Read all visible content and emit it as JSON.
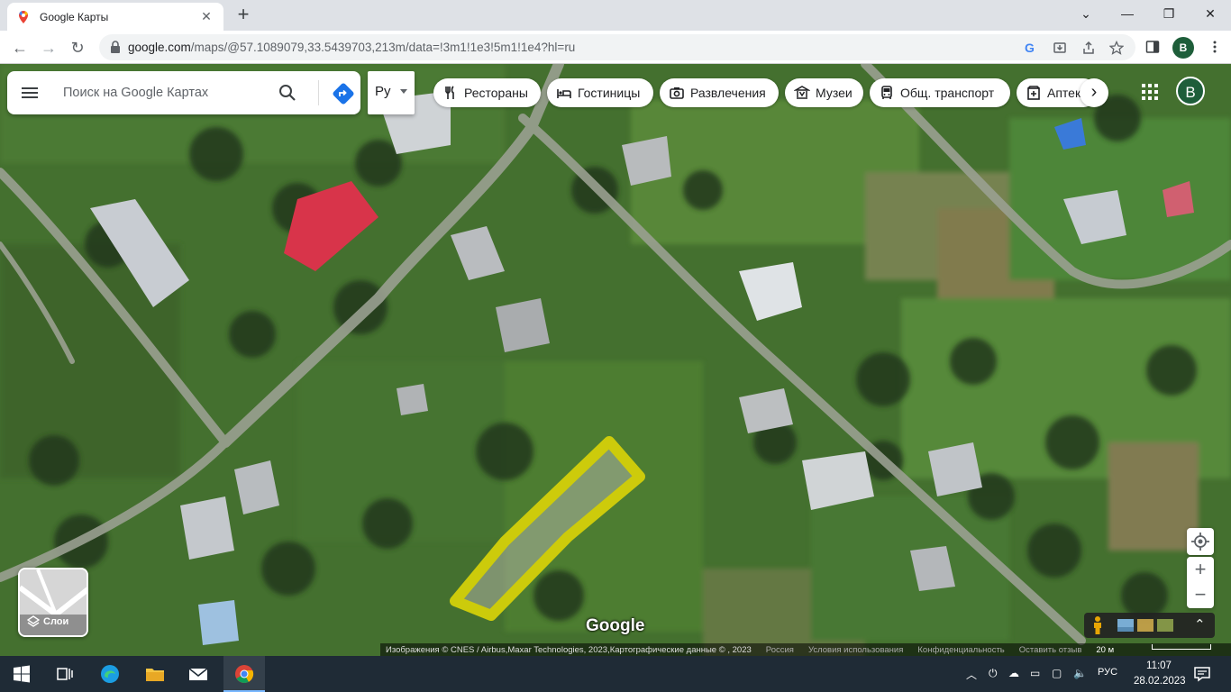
{
  "browser": {
    "tab_title": "Google Карты",
    "url_host": "google.com",
    "url_path": "/maps/@57.1089079,33.5439703,213m/data=!3m1!1e3!5m1!1e4?hl=ru",
    "profile_initial": "В"
  },
  "maps": {
    "search_placeholder": "Поиск на Google Картах",
    "language": "Ру",
    "chips": [
      "Рестораны",
      "Гостиницы",
      "Развлечения",
      "Музеи",
      "Общ. транспорт",
      "Аптеки"
    ],
    "avatar_initial": "В",
    "layers_label": "Слои",
    "google_logo": "Google",
    "attribution": "Изображения © CNES / Airbus,Maxar Technologies, 2023,Картографические данные © , 2023",
    "footer_links": [
      "Россия",
      "Условия использования",
      "Конфиденциальность",
      "Оставить отзыв"
    ],
    "scale": "20 м"
  },
  "taskbar": {
    "language": "РУС",
    "time": "11:07",
    "date": "28.02.2023"
  },
  "colors": {
    "highlight_outline": "#d4d00a",
    "avatar": "#1e5e3a",
    "directions": "#1a73e8"
  }
}
